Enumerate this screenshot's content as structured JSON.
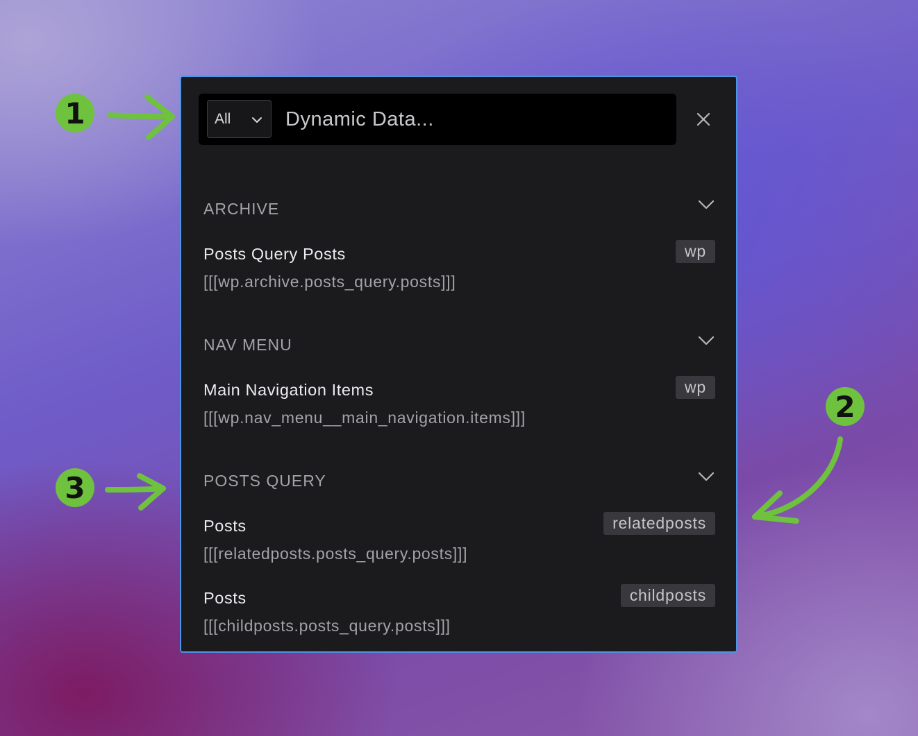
{
  "search": {
    "filter_value": "All",
    "placeholder": "Dynamic Data..."
  },
  "sections": [
    {
      "title": "ARCHIVE",
      "items": [
        {
          "title": "Posts Query Posts",
          "code": "[[[wp.archive.posts_query.posts]]]",
          "tag": "wp"
        }
      ]
    },
    {
      "title": "NAV MENU",
      "items": [
        {
          "title": "Main Navigation Items",
          "code": "[[[wp.nav_menu__main_navigation.items]]]",
          "tag": "wp"
        }
      ]
    },
    {
      "title": "POSTS QUERY",
      "items": [
        {
          "title": "Posts",
          "code": "[[[relatedposts.posts_query.posts]]]",
          "tag": "relatedposts"
        },
        {
          "title": "Posts",
          "code": "[[[childposts.posts_query.posts]]]",
          "tag": "childposts"
        }
      ]
    }
  ],
  "annotations": {
    "badge_1": "1",
    "badge_2": "2",
    "badge_3": "3",
    "color": "#6fc23e"
  },
  "icons": {
    "filter_chevron": "chevron-down-icon",
    "close": "close-icon",
    "section_chevron": "chevron-down-icon"
  },
  "colors": {
    "panel_bg": "#1b1b1e",
    "panel_border": "#4c94e6",
    "search_bg": "#000000",
    "tag_bg": "#38383d"
  }
}
